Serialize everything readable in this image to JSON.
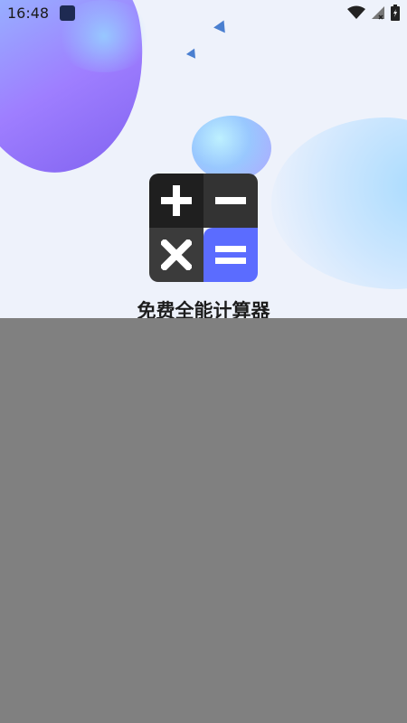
{
  "status_bar": {
    "time": "16:48",
    "icons": [
      "app-icon",
      "wifi-icon",
      "signal-icon",
      "battery-icon"
    ]
  },
  "logo": {
    "symbols": {
      "top_left": "+",
      "top_right": "−",
      "bottom_left": "×",
      "bottom_right": "="
    },
    "colors": {
      "dark": "#1f1f1f",
      "accent": "#5b6cff"
    }
  },
  "app": {
    "name": "免费全能计算器"
  },
  "overlay": {
    "color": "#808080"
  }
}
